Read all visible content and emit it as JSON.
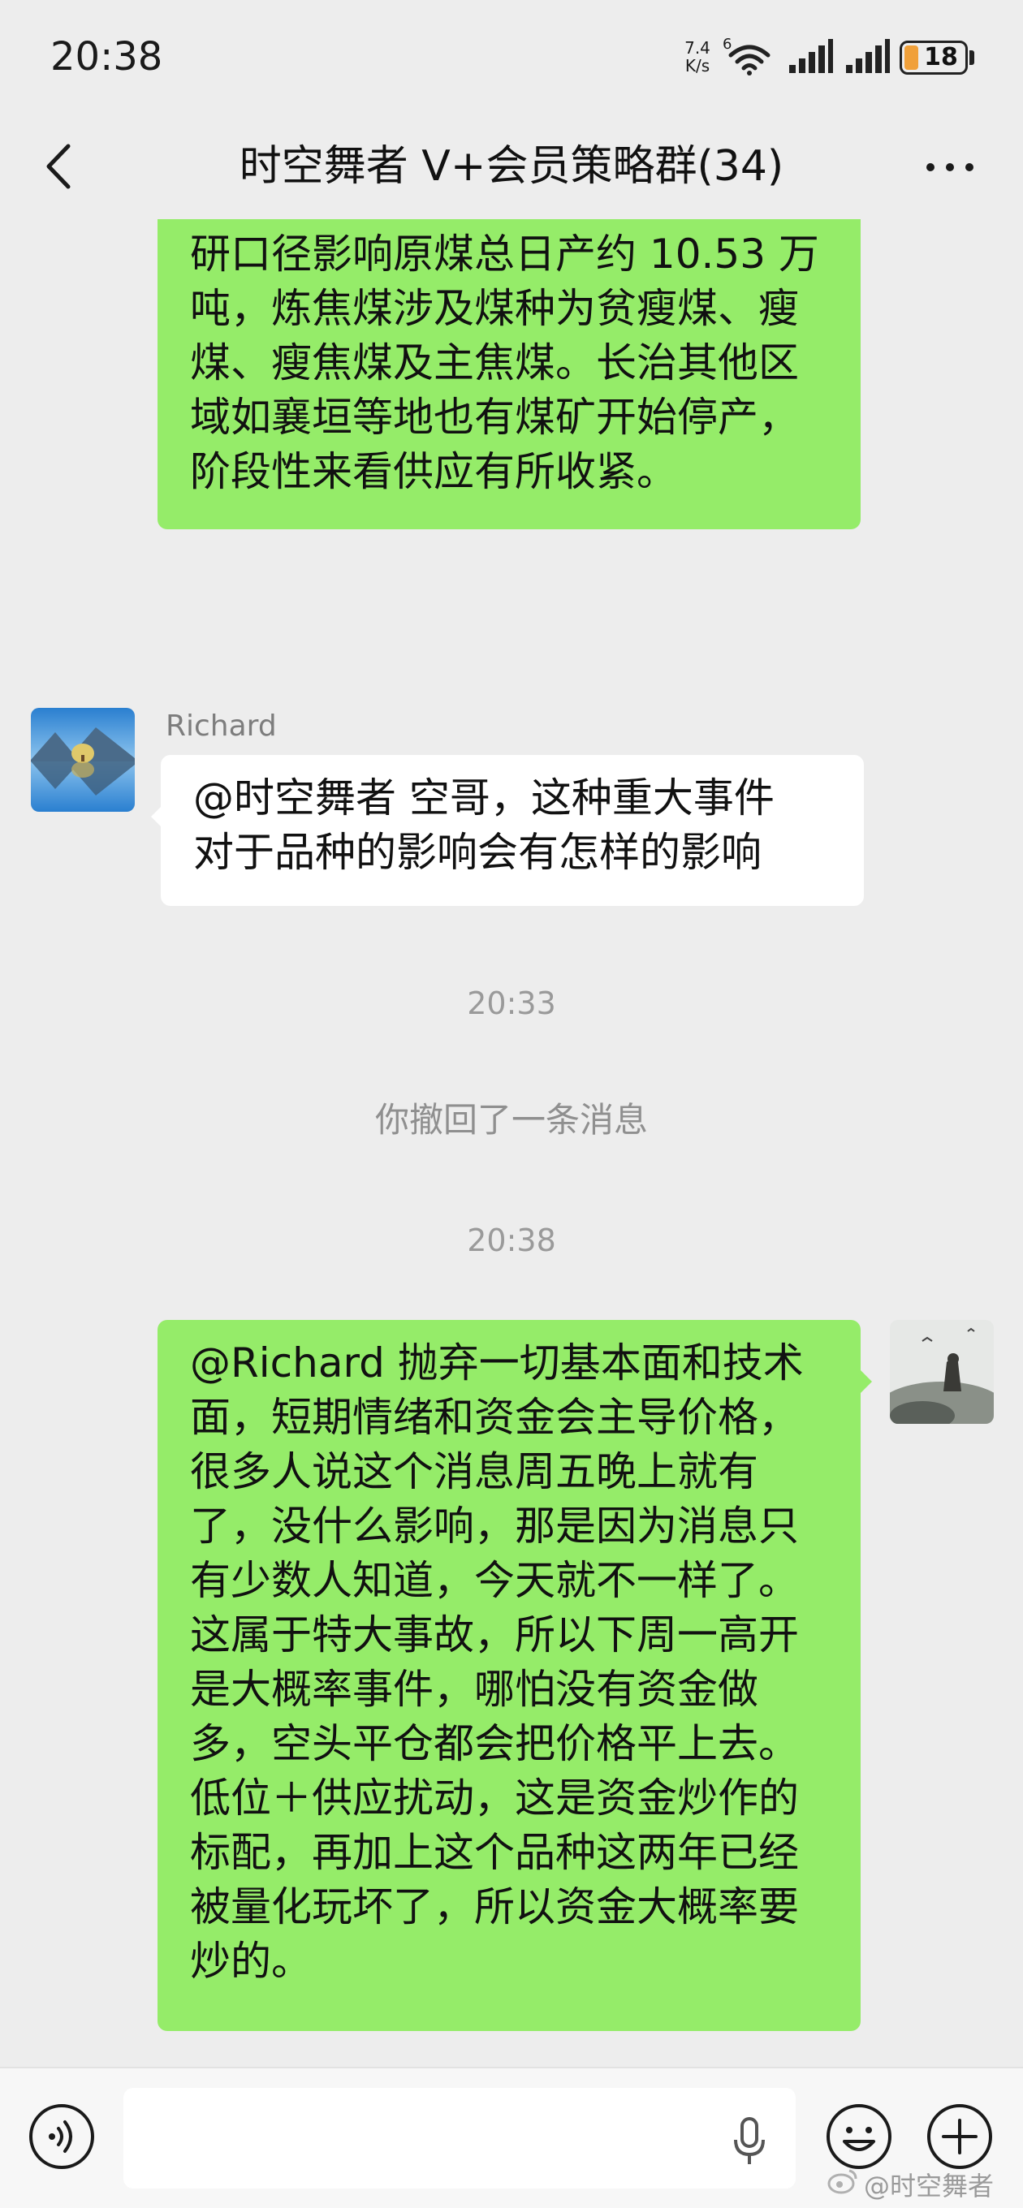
{
  "status_bar": {
    "time": "20:38",
    "net_speed_value": "7.4",
    "net_speed_unit": "K/s",
    "wifi_badge": "6",
    "battery": "18",
    "icons": [
      "wifi-icon",
      "signal-icon",
      "signal-icon",
      "battery-icon"
    ]
  },
  "header": {
    "title": "时空舞者 V+会员策略群(34)",
    "back_icon": "chevron-left-icon",
    "more_icon": "more-dots-icon"
  },
  "messages": [
    {
      "sender": "me",
      "lines": [
        "研口径影响原煤总日产约 10.53 万",
        "吨，炼焦煤涉及煤种为贫瘦煤、瘦",
        "煤、瘦焦煤及主焦煤。长治其他区",
        "域如襄垣等地也有煤矿开始停产，",
        "阶段性来看供应有所收紧。"
      ]
    },
    {
      "sender": "Richard",
      "lines": [
        "@时空舞者  空哥，这种重大事件",
        "对于品种的影响会有怎样的影响"
      ]
    },
    {
      "sender": "me",
      "lines": [
        "@Richard 抛弃一切基本面和技术",
        "面，短期情绪和资金会主导价格，",
        "很多人说这个消息周五晚上就有",
        "了，没什么影响，那是因为消息只",
        "有少数人知道，今天就不一样了。",
        "这属于特大事故，所以下周一高开",
        "是大概率事件，哪怕没有资金做",
        "多，空头平仓都会把价格平上去。",
        "低位＋供应扰动，这是资金炒作的",
        "标配，再加上这个品种这两年已经",
        "被量化玩坏了，所以资金大概率要",
        "炒的。"
      ]
    }
  ],
  "timestamps": [
    "20:33",
    "20:38"
  ],
  "system_message": "你撤回了一条消息",
  "input_bar": {
    "text_value": "",
    "icons": [
      "voice-icon",
      "microphone-icon",
      "emoji-icon",
      "plus-icon"
    ]
  },
  "watermark": "@时空舞者",
  "colors": {
    "background": "#ededed",
    "my_bubble": "#95ec69",
    "their_bubble": "#ffffff"
  }
}
